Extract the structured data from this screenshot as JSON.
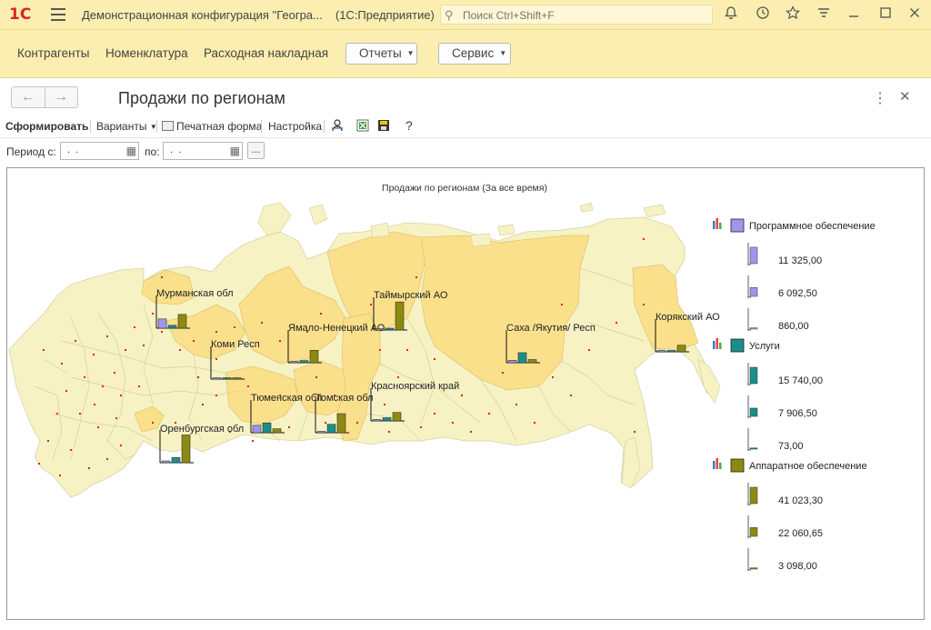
{
  "window": {
    "logo": "1С",
    "title": "Демонстрационная конфигурация \"Геогра...",
    "app": "(1С:Предприятие)",
    "search_placeholder": "Поиск Ctrl+Shift+F"
  },
  "nav": {
    "links": [
      "Контрагенты",
      "Номенклатура",
      "Расходная накладная"
    ],
    "reports_label": "Отчеты",
    "service_label": "Сервис"
  },
  "page": {
    "title": "Продажи по регионам"
  },
  "commands": {
    "generate": "Сформировать",
    "variants": "Варианты",
    "print_form": "Печатная форма",
    "settings": "Настройка",
    "help": "?"
  },
  "period": {
    "from_label": "Период с:",
    "to_label": "по:",
    "from_value": " .  .",
    "to_value": " .  .",
    "dots": "..."
  },
  "chart_data": {
    "type": "bar",
    "title": "Продажи по регионам (За все время)",
    "series_names": [
      "Программное обеспечение",
      "Услуги",
      "Аппаратное обеспечение"
    ],
    "colors": [
      "#9e96ec",
      "#1a8f8a",
      "#8c8a10"
    ],
    "regions": [
      {
        "name": "Мурманская обл",
        "values": [
          3500,
          1100,
          5200
        ]
      },
      {
        "name": "Коми Респ",
        "values": [
          0,
          0,
          0
        ]
      },
      {
        "name": "Ямало-Ненецкий АО",
        "values": [
          0,
          800,
          4700
        ]
      },
      {
        "name": "Таймырский АО",
        "values": [
          0,
          500,
          10600
        ]
      },
      {
        "name": "Саха /Якутия/ Респ",
        "values": [
          900,
          3800,
          1200
        ]
      },
      {
        "name": "Корякский АО",
        "values": [
          0,
          0,
          2500
        ]
      },
      {
        "name": "Тюменская обл",
        "values": [
          2800,
          3700,
          1500
        ]
      },
      {
        "name": "Томская обл",
        "values": [
          0,
          3200,
          7200
        ]
      },
      {
        "name": "Красноярский край",
        "values": [
          0,
          1200,
          3200
        ]
      },
      {
        "name": "Оренбургская обл",
        "values": [
          600,
          2000,
          10500
        ]
      }
    ],
    "legend": [
      {
        "name": "Программное обеспечение",
        "ticks": [
          "11 325,00",
          "6 092,50",
          "860,00"
        ],
        "values": [
          11325,
          6092.5,
          860
        ]
      },
      {
        "name": "Услуги",
        "ticks": [
          "15 740,00",
          "7 906,50",
          "73,00"
        ],
        "values": [
          15740,
          7906.5,
          73
        ]
      },
      {
        "name": "Аппаратное обеспечение",
        "ticks": [
          "41 023,30",
          "22 060,65",
          "3 098,00"
        ],
        "values": [
          41023.3,
          22060.65,
          3098
        ]
      }
    ]
  }
}
